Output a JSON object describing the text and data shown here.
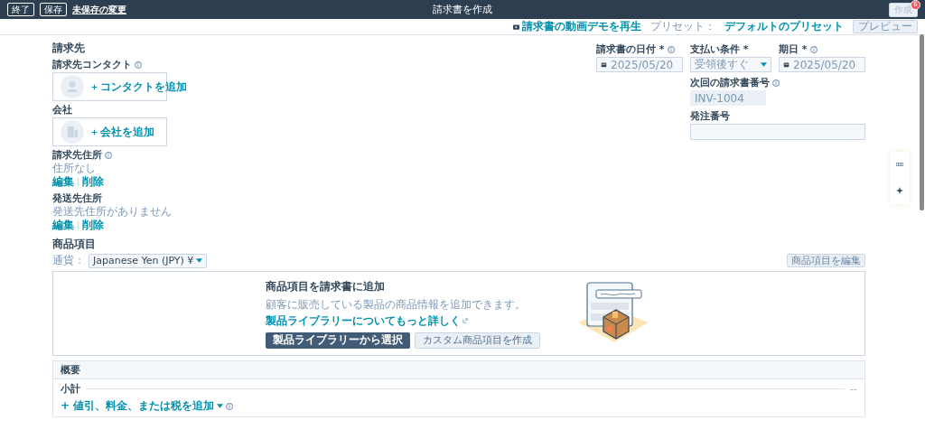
{
  "topbar": {
    "buttons": [
      {
        "label": "終了"
      },
      {
        "label": "保存"
      }
    ],
    "unsaved_link": "未保存の変更",
    "title": "請求書を作成",
    "create_button": {
      "label": "作成",
      "disabled": true,
      "badge": "6"
    }
  },
  "subbar": {
    "demo_link": "請求書の動画デモを再生",
    "preset_label": "プリセット：",
    "preset_value": "デフォルトのプリセット",
    "preview_button": {
      "label": "プレビュー",
      "disabled": true
    }
  },
  "bill_to": {
    "title": "請求先",
    "contact": {
      "label": "請求先コンタクト",
      "add": "コンタクトを追加"
    },
    "company": {
      "label": "会社",
      "add": "会社を追加"
    },
    "billing_address": {
      "label": "請求先住所",
      "value": "住所なし",
      "edit": "編集",
      "delete": "削除"
    },
    "shipping_address": {
      "label": "発送先住所",
      "value": "発送先住所がありません",
      "edit": "編集",
      "delete": "削除"
    }
  },
  "fields": [
    {
      "label": "請求書の日付 *",
      "kind": "date",
      "value": "2025/05/20"
    },
    {
      "label": "支払い条件 *",
      "kind": "select",
      "value": "受領後すぐ"
    },
    {
      "label": "期日 *",
      "kind": "date",
      "value": "2025/05/20"
    },
    {
      "label": "次回の請求書番号",
      "kind": "readonly",
      "value": "INV-1004"
    },
    {
      "label": "発注番号",
      "kind": "text"
    }
  ],
  "line_items": {
    "title": "商品項目",
    "currency_label": "通貨：",
    "currency": "Japanese Yen (JPY) ¥",
    "edit_button": {
      "label": "商品項目を編集",
      "disabled": true
    },
    "empty": {
      "title": "商品項目を請求書に追加",
      "description": "顧客に販売している製品の商品情報を追加できます。",
      "link": "製品ライブラリーについてもっと詳しく",
      "primary": "製品ライブラリーから選択",
      "secondary": "カスタム商品項目を作成"
    }
  },
  "summary": {
    "title": "概要",
    "subtotal_label": "小計",
    "subtotal_value": "--",
    "add_link": "+ 値引、料金、または税を追加"
  }
}
